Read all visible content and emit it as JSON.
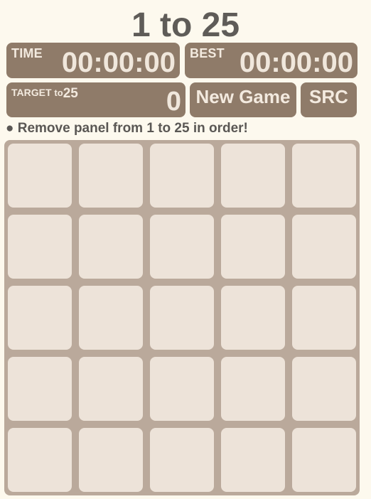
{
  "title": "1 to 25",
  "stats": {
    "time_label": "TIME",
    "time_value": "00:00:00",
    "best_label": "BEST",
    "best_value": "00:00:00",
    "target_label": "TARGET",
    "target_to": "to",
    "target_max": "25",
    "target_value": "0"
  },
  "buttons": {
    "new_game": "New Game",
    "src": "SRC"
  },
  "instruction": "● Remove panel from 1 to 25 in order!",
  "board": {
    "rows": 5,
    "cols": 5,
    "tiles": [
      "",
      "",
      "",
      "",
      "",
      "",
      "",
      "",
      "",
      "",
      "",
      "",
      "",
      "",
      "",
      "",
      "",
      "",
      "",
      "",
      "",
      "",
      "",
      "",
      ""
    ]
  },
  "colors": {
    "background": "#fdf9ee",
    "panel": "#8f7b69",
    "board": "#baa99b",
    "tile": "#ede3d9",
    "title_text": "#5f5c58"
  }
}
